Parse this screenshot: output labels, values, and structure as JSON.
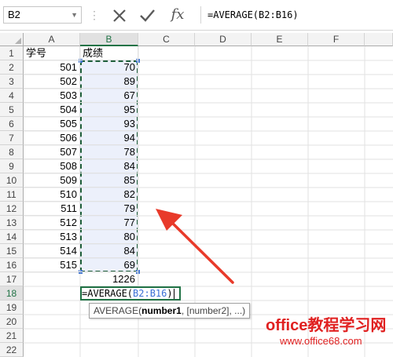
{
  "formula_bar": {
    "name_box": "B2",
    "separator": "⋮",
    "formula": "=AVERAGE(B2:B16)",
    "cancel_icon": "x-icon",
    "enter_icon": "check-icon",
    "fx_label": "fx"
  },
  "columns": [
    "A",
    "B",
    "C",
    "D",
    "E",
    "F"
  ],
  "rows": [
    "1",
    "2",
    "3",
    "4",
    "5",
    "6",
    "7",
    "8",
    "9",
    "10",
    "11",
    "12",
    "13",
    "14",
    "15",
    "16",
    "17",
    "18",
    "19",
    "20",
    "21",
    "22"
  ],
  "table": {
    "header_a": "学号",
    "header_b": "成绩",
    "ids": [
      "501",
      "502",
      "503",
      "504",
      "505",
      "506",
      "507",
      "508",
      "509",
      "510",
      "511",
      "512",
      "513",
      "514",
      "515"
    ],
    "scores": [
      "70",
      "89",
      "67",
      "95",
      "93",
      "94",
      "78",
      "84",
      "85",
      "82",
      "79",
      "77",
      "80",
      "84",
      "69"
    ],
    "total": "1226"
  },
  "editing": {
    "prefix": "=AVERAGE(",
    "ref": "B2:B16",
    "suffix": ")"
  },
  "tooltip": {
    "func": "AVERAGE(",
    "arg1": "number1",
    "rest": ", [number2], ...)"
  },
  "watermark": {
    "line1": "office教程学习网",
    "line2": "www.office68.com"
  },
  "colors": {
    "accent": "#217346",
    "ref_blue": "#3a6fd6",
    "arrow_red": "#e83a2a",
    "watermark_red": "#e02020"
  }
}
